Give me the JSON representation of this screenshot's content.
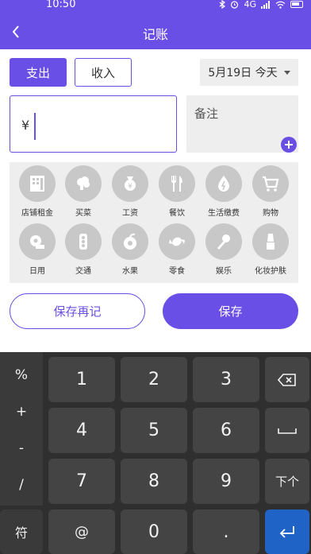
{
  "statusbar": {
    "time": "10:50",
    "signal_text": "4G"
  },
  "header": {
    "title": "记账"
  },
  "type_tabs": {
    "expense": "支出",
    "income": "收入"
  },
  "date": {
    "label": "5月19日 今天"
  },
  "amount": {
    "currency": "¥"
  },
  "note": {
    "label": "备注"
  },
  "categories": [
    {
      "label": "店铺租金",
      "icon": "building-icon"
    },
    {
      "label": "买菜",
      "icon": "vegetable-icon"
    },
    {
      "label": "工资",
      "icon": "money-bag-icon"
    },
    {
      "label": "餐饮",
      "icon": "utensils-icon"
    },
    {
      "label": "生活缴费",
      "icon": "water-drop-icon"
    },
    {
      "label": "购物",
      "icon": "cart-icon"
    },
    {
      "label": "日用",
      "icon": "tissue-icon"
    },
    {
      "label": "交通",
      "icon": "traffic-light-icon"
    },
    {
      "label": "水果",
      "icon": "fruit-icon"
    },
    {
      "label": "零食",
      "icon": "candy-icon"
    },
    {
      "label": "娱乐",
      "icon": "microphone-icon"
    },
    {
      "label": "化妆护肤",
      "icon": "cosmetics-icon"
    }
  ],
  "actions": {
    "save_again": "保存再记",
    "save": "保存"
  },
  "keyboard": {
    "side": [
      "%",
      "+",
      "-",
      "/"
    ],
    "digits": [
      "1",
      "2",
      "3",
      "4",
      "5",
      "6",
      "7",
      "8",
      "9",
      "0"
    ],
    "symbol_key": "符",
    "at_key": "@",
    "dot_key": ".",
    "next_key": "下个"
  },
  "colors": {
    "accent": "#6A4FE6",
    "enter": "#1f63c7",
    "keyboard_bg": "#2f2f2f"
  }
}
